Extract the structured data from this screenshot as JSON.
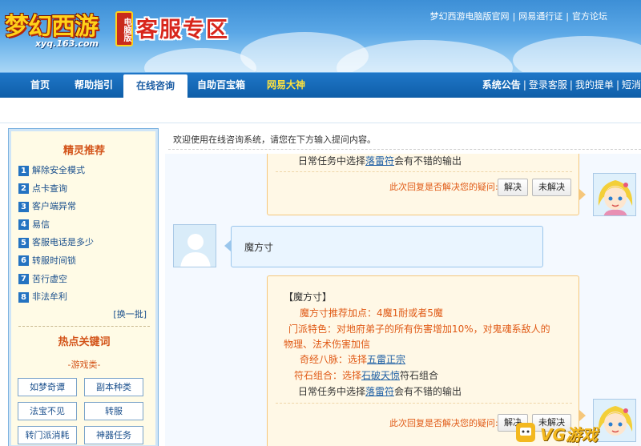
{
  "header": {
    "logo_text": "梦幻西游",
    "logo_badge": "电脑版",
    "logo_url": "xyq.163.com",
    "site_title": "客服专区",
    "top_links": [
      "梦幻西游电脑版官网",
      "网易通行证",
      "官方论坛"
    ]
  },
  "nav": {
    "items": [
      "首页",
      "帮助指引",
      "在线咨询",
      "自助百宝箱",
      "网易大神"
    ],
    "active": "在线咨询",
    "right_title": "系统公告",
    "right_links": [
      "登录客服",
      "我的提单",
      "短消"
    ]
  },
  "sidebar": {
    "title": "精灵推荐",
    "items": [
      {
        "num": "1",
        "label": "解除安全模式"
      },
      {
        "num": "2",
        "label": "点卡查询"
      },
      {
        "num": "3",
        "label": "客户端异常"
      },
      {
        "num": "4",
        "label": "易信"
      },
      {
        "num": "5",
        "label": "客服电话是多少"
      },
      {
        "num": "6",
        "label": "转服时间锁"
      },
      {
        "num": "7",
        "label": "苦行虚空"
      },
      {
        "num": "8",
        "label": "非法牟利"
      }
    ],
    "more": "[换一批]",
    "hot_title": "热点关键词",
    "hot_sub": "-游戏类-",
    "keywords": [
      "如梦奇谭",
      "副本种类",
      "法宝不见",
      "转服",
      "转门派消耗",
      "神器任务"
    ]
  },
  "main": {
    "welcome": "欢迎使用在线咨询系统，请您在下方输入提问内容。",
    "msg1": {
      "text_pre": "日常任务中选择",
      "link": "落雷符",
      "text_post": "会有不错的输出"
    },
    "feedback_prompt": "此次回复是否解决您的疑问:",
    "btn_solved": "解决",
    "btn_unsolved": "未解决",
    "user_msg": "魔方寸",
    "msg2": {
      "title": "【魔方寸】",
      "line1": "魔方寸推荐加点：4魔1耐或者5魔",
      "line2": "门派特色：对地府弟子的所有伤害增加10%，对鬼魂系敌人的",
      "line3": "物理、法术伤害加信",
      "line4_pre": "奇经八脉：选择",
      "line4_link": "五雷正宗",
      "line5_pre": "符石组合：选择",
      "line5_link": "石破天惊",
      "line5_post": "符石组合",
      "line6_pre": "日常任务中选择",
      "line6_link": "落雷符",
      "line6_post": "会有不错的输出"
    }
  },
  "watermark": "VG游戏"
}
